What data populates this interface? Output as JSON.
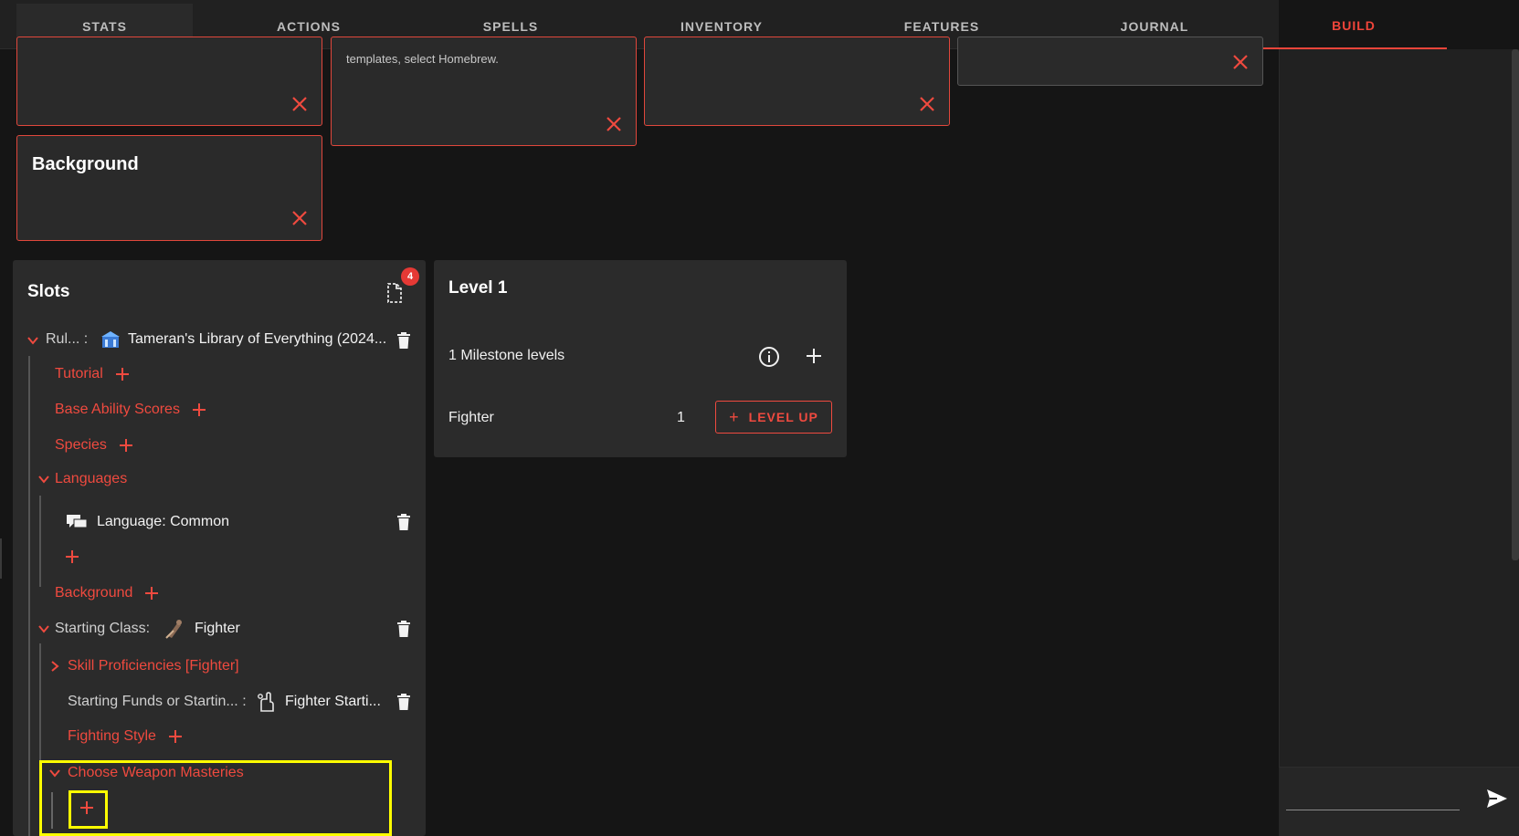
{
  "tabs": [
    {
      "label": "STATS"
    },
    {
      "label": "ACTIONS"
    },
    {
      "label": "SPELLS"
    },
    {
      "label": "INVENTORY"
    },
    {
      "label": "FEATURES"
    },
    {
      "label": "JOURNAL"
    },
    {
      "label": "BUILD"
    }
  ],
  "active_tab": "BUILD",
  "cards": {
    "homebrew_text": "templates, select Homebrew.",
    "background_title": "Background"
  },
  "slots": {
    "heading": "Slots",
    "badge_count": "4",
    "ruleset_label": "Rul... :",
    "ruleset_value": "Tameran's Library of Everything (2024...",
    "tutorial": "Tutorial",
    "base_ability_scores": "Base Ability Scores",
    "species": "Species",
    "languages": "Languages",
    "language_common": "Language: Common",
    "background": "Background",
    "starting_class_label": "Starting Class:",
    "starting_class_value": "Fighter",
    "skill_proficiencies": "Skill Proficiencies [Fighter]",
    "starting_funds_label": "Starting Funds or Startin... :",
    "starting_funds_value": "Fighter Starti...",
    "fighting_style": "Fighting Style",
    "weapon_masteries": "Choose Weapon Masteries"
  },
  "level": {
    "heading": "Level 1",
    "milestone": "1 Milestone levels",
    "class_name": "Fighter",
    "class_level": "1",
    "level_up": "LEVEL UP"
  },
  "colors": {
    "accent": "#ef4a3f",
    "highlight": "#ffff00",
    "background": "#151515",
    "panel": "#2b2b2b"
  }
}
